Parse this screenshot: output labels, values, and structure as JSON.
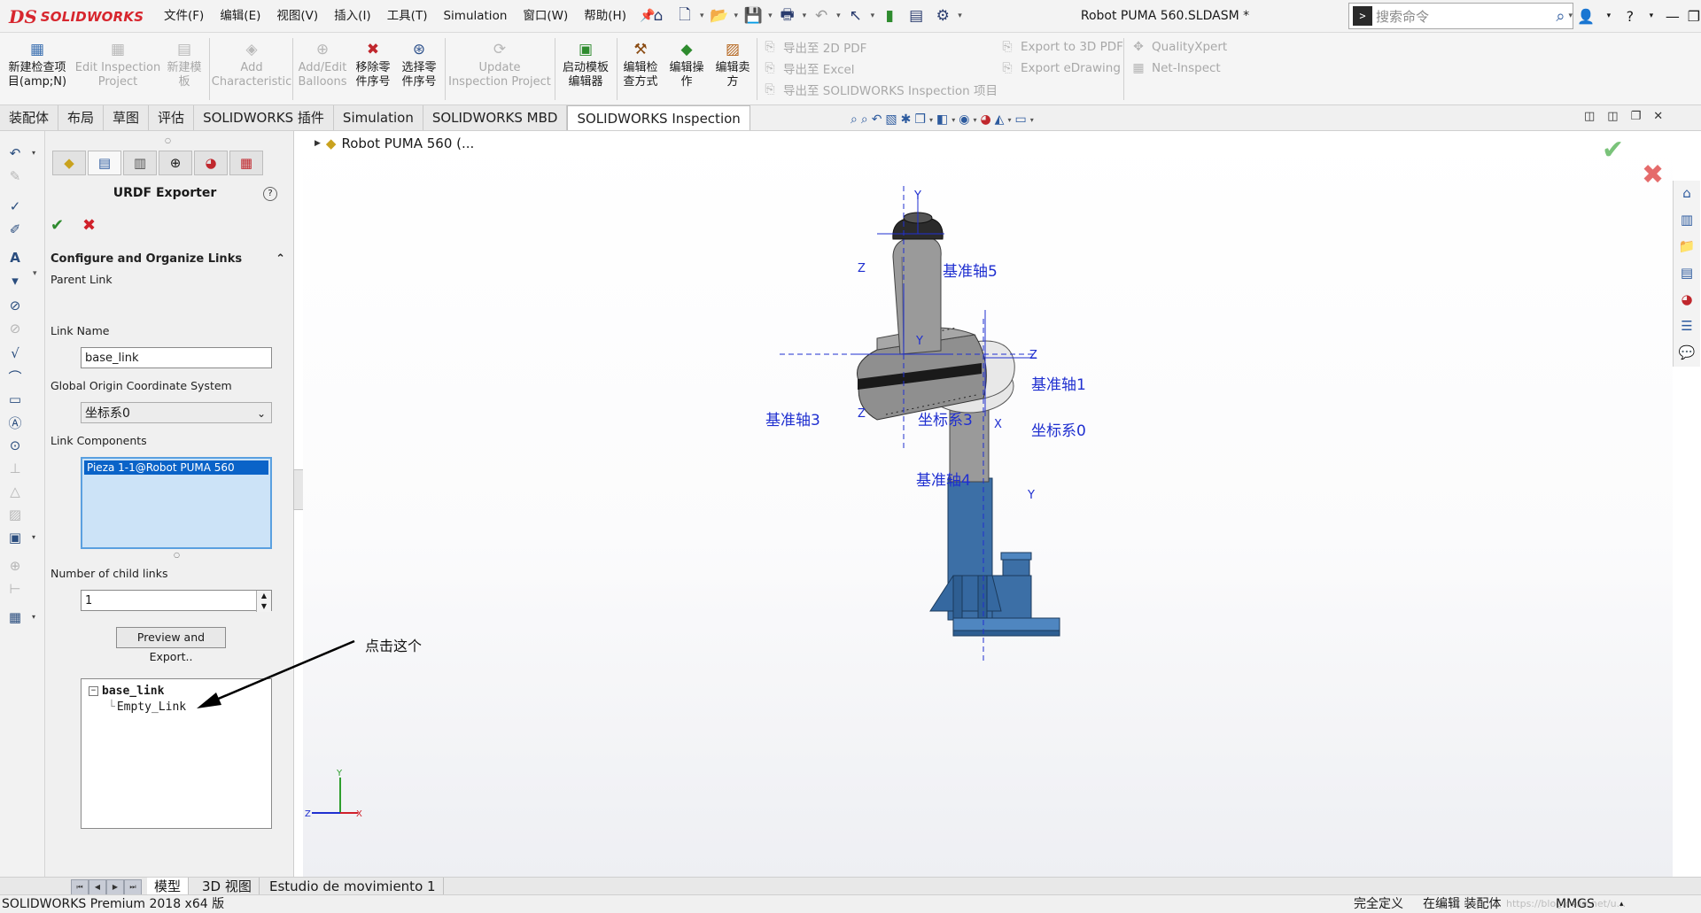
{
  "app": {
    "logo_prefix": "DS",
    "logo_text": "SOLIDWORKS",
    "document_title": "Robot PUMA 560.SLDASM *",
    "menu": [
      "文件(F)",
      "编辑(E)",
      "视图(V)",
      "插入(I)",
      "工具(T)",
      "Simulation",
      "窗口(W)",
      "帮助(H)"
    ],
    "search_placeholder": "搜索命令",
    "help_label": "?"
  },
  "commands": {
    "new_project": "新建检查项目(amp;N)",
    "edit_project": "Edit Inspection Project",
    "new_template": "新建模板",
    "add_characteristic": "Add Characteristic",
    "add_balloons": "Add/Edit Balloons",
    "remove_seq": "移除零件序号",
    "select_seq": "选择零件序号",
    "update_project": "Update Inspection Project",
    "launch_template": "启动模板编辑器",
    "edit_method": "编辑检查方式",
    "edit_operation": "编辑操作",
    "edit_vendor": "编辑卖方",
    "export_2d_pdf": "导出至 2D PDF",
    "export_excel": "导出至 Excel",
    "export_inspection": "导出至 SOLIDWORKS Inspection 项目",
    "export_3d_pdf": "Export to 3D PDF",
    "export_edrawing": "Export eDrawing",
    "qualityxpert": "QualityXpert",
    "net_inspect": "Net-Inspect"
  },
  "tabs": [
    "装配体",
    "布局",
    "草图",
    "评估",
    "SOLIDWORKS 插件",
    "Simulation",
    "SOLIDWORKS MBD",
    "SOLIDWORKS Inspection"
  ],
  "active_tab": "SOLIDWORKS Inspection",
  "panel": {
    "title": "URDF Exporter",
    "section": "Configure and Organize Links",
    "parent_link_label": "Parent Link",
    "link_name_label": "Link Name",
    "link_name_value": "base_link",
    "origin_label": "Global Origin Coordinate System",
    "origin_value": "坐标系0",
    "components_label": "Link Components",
    "component_selected": "Pieza 1-1@Robot PUMA 560",
    "child_links_label": "Number of child links",
    "child_links_value": "1",
    "preview_button": "Preview and Export..",
    "tree_root": "base_link",
    "tree_child": "Empty_Link"
  },
  "graphics": {
    "tree_title": "Robot PUMA 560  (...",
    "annotation": "点击这个",
    "axis_labels": {
      "ref_axis_5": "基准轴5",
      "ref_axis_1": "基准轴1",
      "ref_axis_3": "基准轴3",
      "ref_axis_4": "基准轴4",
      "coord_sys_3": "坐标系3",
      "coord_sys_0": "坐标系0",
      "x": "X",
      "y": "Y",
      "z": "Z"
    }
  },
  "bottom_tabs": [
    "模型",
    "3D 视图",
    "Estudio de movimiento 1"
  ],
  "status": {
    "product": "SOLIDWORKS Premium 2018 x64 版",
    "definition": "完全定义",
    "editing": "在编辑 装配体",
    "units": "MMGS",
    "watermark": "https://blog.csdn.net/u..."
  },
  "colors": {
    "brand_red": "#d7262e",
    "selection_blue": "#0a63c8",
    "axis_blue": "#1f2fd0",
    "robot_base_blue": "#3c6fa6",
    "robot_arm_gray": "#9a9a9a"
  },
  "icons": [
    "search-icon",
    "user-icon",
    "help-icon",
    "minimize-icon",
    "maximize-icon",
    "close-icon",
    "home-icon",
    "new-document-icon",
    "open-icon",
    "save-icon",
    "print-icon",
    "undo-icon",
    "select-icon",
    "rebuild-icon",
    "options-icon"
  ]
}
